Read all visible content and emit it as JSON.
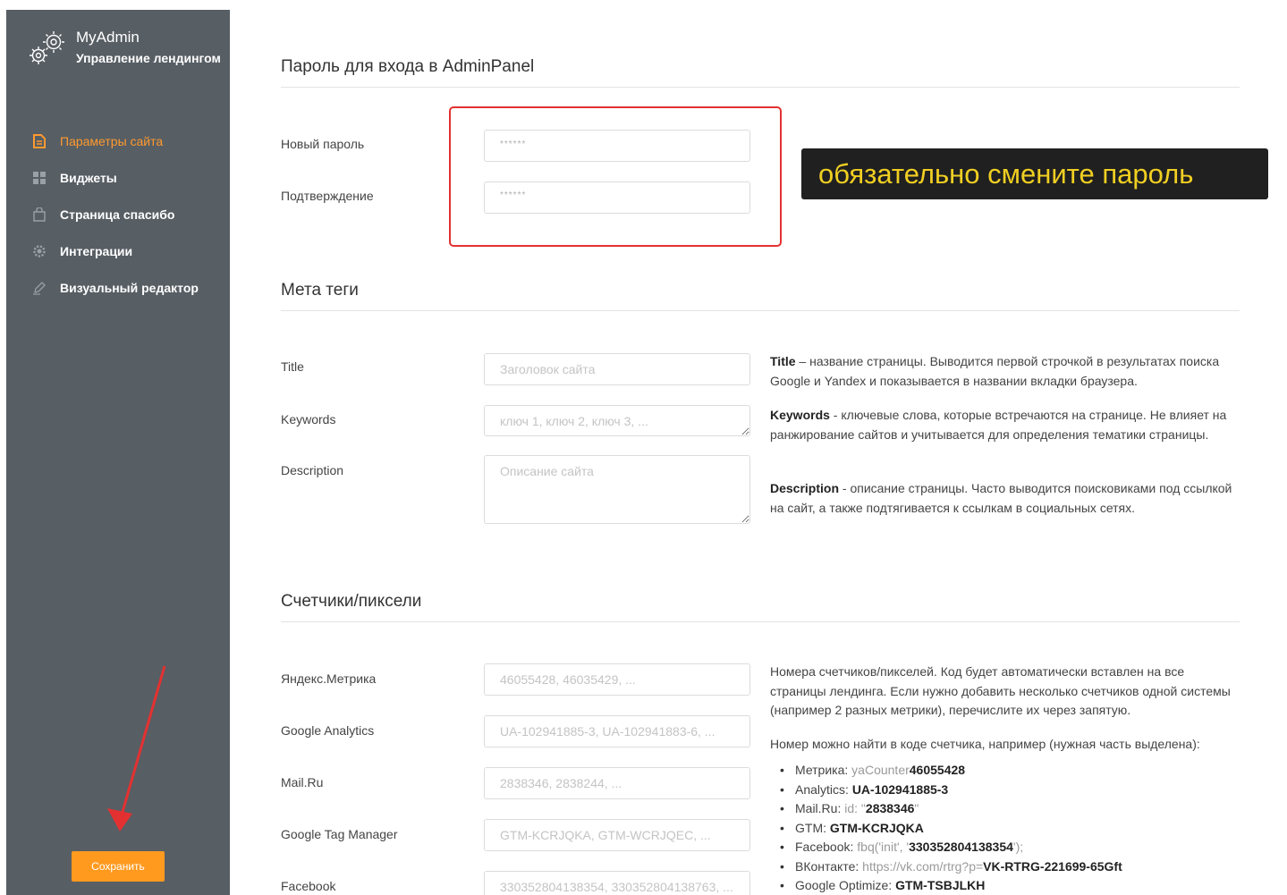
{
  "brand": {
    "title": "MyAdmin",
    "subtitle": "Управление лендингом"
  },
  "sidebar": {
    "items": [
      {
        "label": "Параметры сайта",
        "icon": "document-icon",
        "active": true
      },
      {
        "label": "Виджеты",
        "icon": "grid-icon",
        "active": false
      },
      {
        "label": "Страница спасибо",
        "icon": "bag-icon",
        "active": false
      },
      {
        "label": "Интеграции",
        "icon": "gear-icon",
        "active": false
      },
      {
        "label": "Визуальный редактор",
        "icon": "pencil-icon",
        "active": false
      }
    ],
    "save_label": "Сохранить"
  },
  "colors": {
    "accent": "#ff9a2e",
    "sidebar_bg": "#575e64",
    "warning_text": "#f0cf22",
    "highlight_border": "#e33131"
  },
  "password": {
    "title": "Пароль для входа в AdminPanel",
    "new_label": "Новый пароль",
    "new_placeholder": "******",
    "confirm_label": "Подтверждение",
    "confirm_placeholder": "******",
    "warning": "обязательно смените пароль"
  },
  "meta": {
    "title": "Мета теги",
    "title_label": "Title",
    "title_placeholder": "Заголовок сайта",
    "keywords_label": "Keywords",
    "keywords_placeholder": "ключ 1, ключ 2, ключ 3, ...",
    "description_label": "Description",
    "description_placeholder": "Описание сайта",
    "help_title_term": "Title",
    "help_title_text": " – название страницы. Выводится первой строчкой в результатах поиска Google и Yandex и показывается в названии вкладки браузера.",
    "help_keywords_term": "Keywords",
    "help_keywords_text": " - ключевые слова, которые встречаются на странице. Не влияет на ранжирование сайтов и учитывается для определения тематики страницы.",
    "help_description_term": "Description",
    "help_description_text": " - описание страницы. Часто выводится поисковиками под ссылкой на сайт, а также подтягивается к ссылкам в социальных сетях."
  },
  "counters": {
    "title": "Счетчики/пиксели",
    "fields": [
      {
        "label": "Яндекс.Метрика",
        "placeholder": "46055428, 46035429, ..."
      },
      {
        "label": "Google Analytics",
        "placeholder": "UA-102941885-3, UA-102941883-6, ..."
      },
      {
        "label": "Mail.Ru",
        "placeholder": "2838346, 2838244, ..."
      },
      {
        "label": "Google Tag Manager",
        "placeholder": "GTM-KCRJQKA, GTM-WCRJQEC, ..."
      },
      {
        "label": "Facebook",
        "placeholder": "330352804138354, 330352804138763, ..."
      }
    ],
    "help_intro": "Номера счетчиков/пикселей. Код будет автоматически вставлен на все страницы лендинга. Если нужно добавить несколько счетчиков одной системы (например 2 разных метрики), перечислите их через запятую.",
    "help_hint": "Номер можно найти в коде счетчика, например (нужная часть выделена):",
    "examples": [
      {
        "name": "Метрика:",
        "pre": " yaCounter",
        "code": "46055428",
        "post": ""
      },
      {
        "name": "Analytics:",
        "pre": " ",
        "code": "UA-102941885-3",
        "post": ""
      },
      {
        "name": "Mail.Ru:",
        "pre": " id: \"",
        "code": "2838346",
        "post": "\""
      },
      {
        "name": "GTM:",
        "pre": " ",
        "code": "GTM-KCRJQKA",
        "post": ""
      },
      {
        "name": "Facebook:",
        "pre": " fbq('init', '",
        "code": "330352804138354",
        "post": "');"
      },
      {
        "name": "ВКонтакте:",
        "pre": " https://vk.com/rtrg?p=",
        "code": "VK-RTRG-221699-65Gft",
        "post": ""
      },
      {
        "name": "Google Optimize:",
        "pre": " ",
        "code": "GTM-TSBJLKH",
        "post": ""
      }
    ]
  }
}
